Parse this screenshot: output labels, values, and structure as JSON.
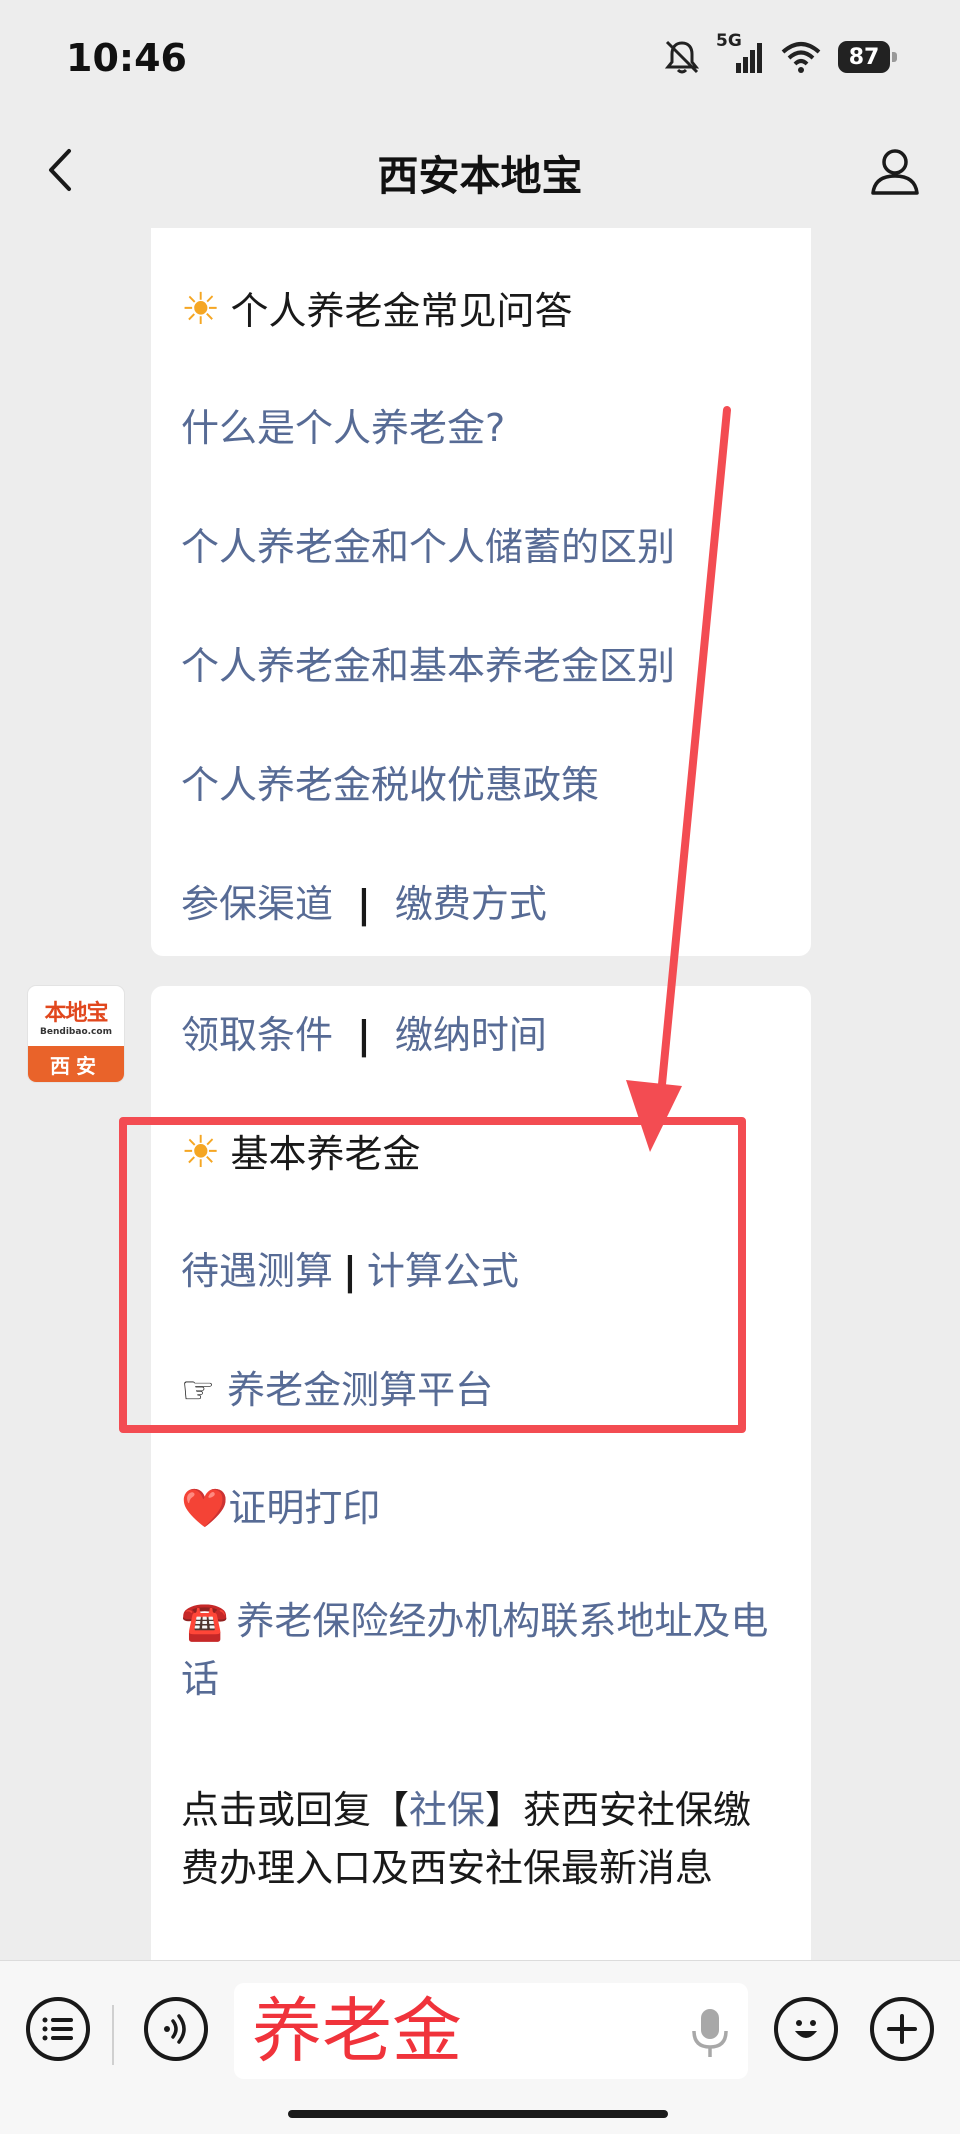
{
  "status_bar": {
    "time": "10:46",
    "network": "5G",
    "battery": "87"
  },
  "nav": {
    "title": "西安本地宝"
  },
  "bubble1": {
    "heading": "个人养老金常见问答",
    "links": [
      "什么是个人养老金?",
      "个人养老金和个人储蓄的区别",
      "个人养老金和基本养老金区别",
      "个人养老金税收优惠政策"
    ],
    "pair_left": "参保渠道",
    "pair_right": "缴费方式",
    "separator": "|"
  },
  "avatar": {
    "brand": "本地宝",
    "brand_sub": "Bendibao.com",
    "city": "西安"
  },
  "bubble2": {
    "pair_left": "领取条件",
    "pair_right": "缴纳时间",
    "separator": "|",
    "heading": "基本养老金",
    "calc_left": "待遇测算",
    "calc_right": "计算公式",
    "platform_icon": "☞",
    "platform_label": "养老金测算平台",
    "cert_icon": "❤️",
    "cert_label": "证明打印",
    "phone_icon": "☎️",
    "contact_label": "养老保险经办机构联系地址及电话",
    "reply_before": "点击或回复【",
    "reply_keyword": "社保",
    "reply_after": "】获西安社保缴费办理入口及西安社保最新消息"
  },
  "input_bar": {
    "value": "养老金"
  },
  "colors": {
    "link": "#576b95",
    "highlight": "#f34c52",
    "input_text": "#f0333b"
  }
}
